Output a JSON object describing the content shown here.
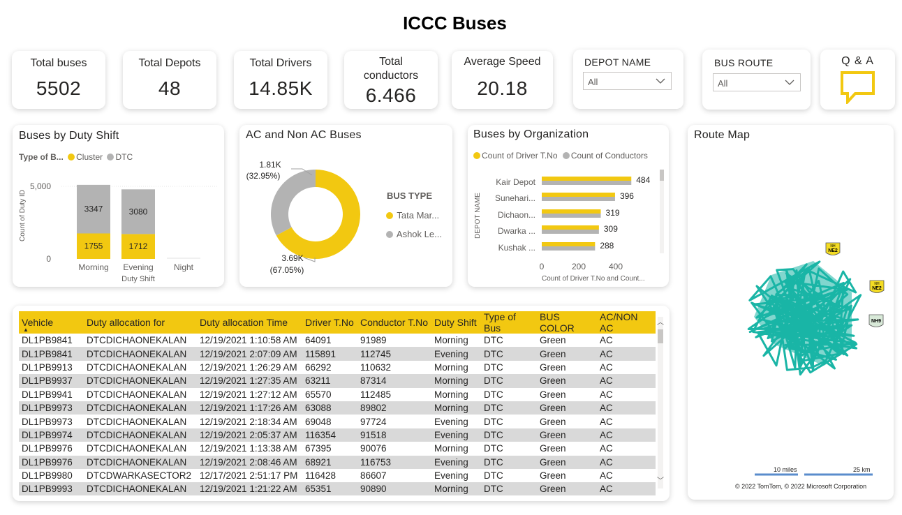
{
  "page": {
    "title": "ICCC Buses"
  },
  "kpis": [
    {
      "label": "Total buses",
      "value": "5502"
    },
    {
      "label": "Total Depots",
      "value": "48"
    },
    {
      "label": "Total Drivers",
      "value": "14.85K"
    },
    {
      "label": "Total conductors",
      "value": "6.466"
    },
    {
      "label": "Average Speed",
      "value": "20.18"
    }
  ],
  "slicers": {
    "depot": {
      "label": "DEPOT NAME",
      "value": "All"
    },
    "route": {
      "label": "BUS ROUTE",
      "value": "All"
    }
  },
  "qa": {
    "label": "Q & A",
    "icon": "chat-bubble-icon"
  },
  "colors": {
    "accent": "#F2C811",
    "gray": "#B3B3B3",
    "route": "#1AB5A6"
  },
  "duty_shift_chart": {
    "title": "Buses by Duty Shift",
    "legend_title": "Type of B...",
    "legend": [
      "Cluster",
      "DTC"
    ],
    "y_axis_label": "Count of Duty ID",
    "x_axis_label": "Duty Shift",
    "y_ticks": [
      "5,000",
      "0"
    ]
  },
  "ac_chart": {
    "title": "AC and Non AC Buses",
    "legend_title": "BUS TYPE",
    "legend": [
      "Tata Mar...",
      "Ashok Le..."
    ],
    "label_gray_value": "1.81K",
    "label_gray_pct": "(32.95%)",
    "label_yellow_value": "3.69K",
    "label_yellow_pct": "(67.05%)"
  },
  "org_chart": {
    "title": "Buses by Organization",
    "legend": [
      "Count of Driver T.No",
      "Count of Conductors"
    ],
    "y_axis_label": "DEPOT NAME",
    "x_axis_label": "Count of Driver T.No and Count...",
    "x_ticks": [
      "0",
      "200",
      "400"
    ]
  },
  "chart_data": [
    {
      "type": "bar",
      "title": "Buses by Duty Shift",
      "stacked": true,
      "categories": [
        "Morning",
        "Evening",
        "Night"
      ],
      "series": [
        {
          "name": "Cluster",
          "values": [
            1755,
            1712,
            0
          ]
        },
        {
          "name": "DTC",
          "values": [
            3347,
            3080,
            0
          ]
        }
      ],
      "xlabel": "Duty Shift",
      "ylabel": "Count of Duty ID",
      "ylim": [
        0,
        5000
      ]
    },
    {
      "type": "pie",
      "title": "AC and Non AC Buses",
      "donut": true,
      "categories": [
        "Tata Mar...",
        "Ashok Le..."
      ],
      "values": [
        3690,
        1810
      ],
      "percents": [
        67.05,
        32.95
      ]
    },
    {
      "type": "bar",
      "title": "Buses by Organization",
      "orientation": "horizontal",
      "categories": [
        "Kair Depot",
        "Sunehari...",
        "Dichaon...",
        "Dwarka ...",
        "Kushak ..."
      ],
      "series": [
        {
          "name": "Count of Driver T.No",
          "values": [
            484,
            396,
            319,
            309,
            288
          ]
        },
        {
          "name": "Count of Conductors",
          "values": [
            484,
            396,
            319,
            309,
            288
          ]
        }
      ],
      "xlabel": "Count of Driver T.No and Count...",
      "ylabel": "DEPOT NAME",
      "xlim": [
        0,
        480
      ]
    }
  ],
  "table": {
    "columns": [
      "Vehicle",
      "Duty allocation for",
      "Duty allocation Time",
      "Driver T.No",
      "Conductor T.No",
      "Duty Shift",
      "Type of Bus",
      "BUS COLOR",
      "AC/NON AC"
    ],
    "rows": [
      [
        "DL1PB9841",
        "DTCDICHAONEKALAN",
        "12/19/2021 1:10:58 AM",
        "64091",
        "91989",
        "Morning",
        "DTC",
        "Green",
        "AC"
      ],
      [
        "DL1PB9841",
        "DTCDICHAONEKALAN",
        "12/19/2021 2:07:09 AM",
        "115891",
        "112745",
        "Evening",
        "DTC",
        "Green",
        "AC"
      ],
      [
        "DL1PB9913",
        "DTCDICHAONEKALAN",
        "12/19/2021 1:26:29 AM",
        "66292",
        "110632",
        "Morning",
        "DTC",
        "Green",
        "AC"
      ],
      [
        "DL1PB9937",
        "DTCDICHAONEKALAN",
        "12/19/2021 1:27:35 AM",
        "63211",
        "87314",
        "Morning",
        "DTC",
        "Green",
        "AC"
      ],
      [
        "DL1PB9941",
        "DTCDICHAONEKALAN",
        "12/19/2021 1:27:12 AM",
        "65570",
        "112485",
        "Morning",
        "DTC",
        "Green",
        "AC"
      ],
      [
        "DL1PB9973",
        "DTCDICHAONEKALAN",
        "12/19/2021 1:17:26 AM",
        "63088",
        "89802",
        "Morning",
        "DTC",
        "Green",
        "AC"
      ],
      [
        "DL1PB9973",
        "DTCDICHAONEKALAN",
        "12/19/2021 2:18:34 AM",
        "69048",
        "97724",
        "Evening",
        "DTC",
        "Green",
        "AC"
      ],
      [
        "DL1PB9974",
        "DTCDICHAONEKALAN",
        "12/19/2021 2:05:37 AM",
        "116354",
        "91518",
        "Evening",
        "DTC",
        "Green",
        "AC"
      ],
      [
        "DL1PB9976",
        "DTCDICHAONEKALAN",
        "12/19/2021 1:13:38 AM",
        "67395",
        "90076",
        "Morning",
        "DTC",
        "Green",
        "AC"
      ],
      [
        "DL1PB9976",
        "DTCDICHAONEKALAN",
        "12/19/2021 2:08:46 AM",
        "68921",
        "116753",
        "Evening",
        "DTC",
        "Green",
        "AC"
      ],
      [
        "DL1PB9980",
        "DTCDWARKASECTOR2",
        "12/17/2021 2:51:17 PM",
        "116428",
        "86607",
        "Evening",
        "DTC",
        "Green",
        "AC"
      ],
      [
        "DL1PB9993",
        "DTCDICHAONEKALAN",
        "12/19/2021 1:21:22 AM",
        "65351",
        "90890",
        "Morning",
        "DTC",
        "Green",
        "AC"
      ]
    ]
  },
  "route_map": {
    "title": "Route Map",
    "scale_miles": "10 miles",
    "scale_km": "25 km",
    "credit": "© 2022 TomTom, © 2022 Microsoft Corporation",
    "shields": [
      "NE2",
      "NE2",
      "NH9"
    ],
    "shield_prefix": "NH"
  }
}
